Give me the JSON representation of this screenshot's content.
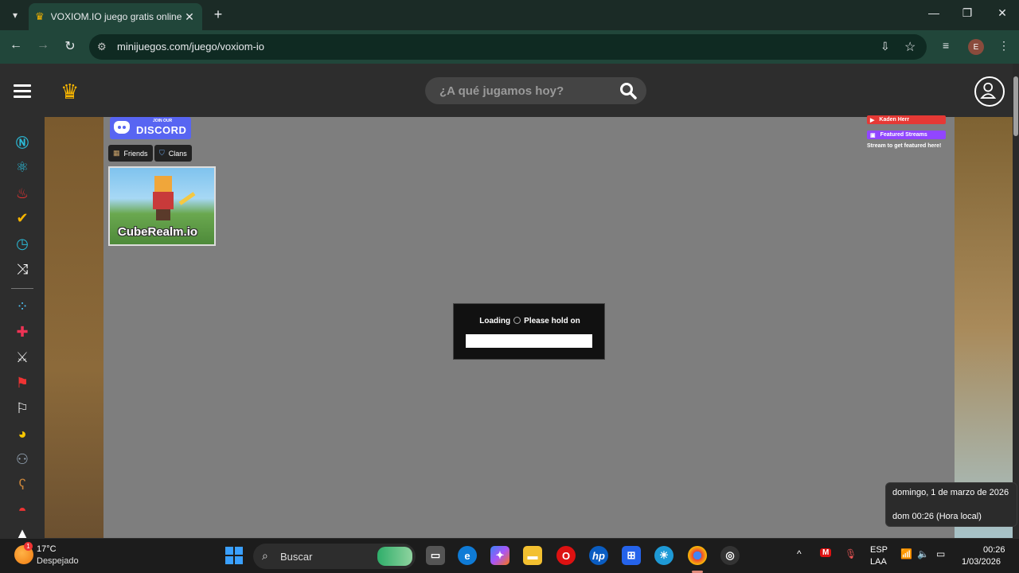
{
  "browser": {
    "tab_title": "VOXIOM.IO juego gratis online",
    "url": "minijuegos.com/juego/voxiom-io",
    "profile_initial": "E"
  },
  "site": {
    "search_placeholder": "¿A qué jugamos hoy?",
    "accent_color": "#f7b500",
    "sidebar_icons": [
      "n-icon",
      "atom-icon",
      "fire-icon",
      "check-icon",
      "clock-icon",
      "shuffle-icon",
      "dots-icon",
      "puzzle-icon",
      "swords-icon",
      "flag-icon",
      "checkered-flag-icon",
      "pacman-icon",
      "people-icon",
      "bear-icon",
      "pokeball-icon",
      "arrow-up-icon"
    ]
  },
  "game": {
    "discord_join": "JOIN OUR",
    "discord_label": "DISCORD",
    "friends_label": "Friends",
    "clans_label": "Clans",
    "promo_title": "CubeRealm.io",
    "stream_user": "Kaden Herr",
    "featured_streams": "Featured Streams",
    "stream_hint": "Stream to get featured here!",
    "loading_text": "Loading",
    "hold_text": "Please hold on"
  },
  "clock_popup": {
    "full_date": "domingo, 1 de marzo de 2026",
    "local_time": "dom 00:26 (Hora local)"
  },
  "taskbar": {
    "temperature": "17°C",
    "weather": "Despejado",
    "weather_badge": "1",
    "search_placeholder": "Buscar",
    "lang_line1": "ESP",
    "lang_line2": "LAA",
    "time": "00:26",
    "date": "1/03/2026"
  }
}
